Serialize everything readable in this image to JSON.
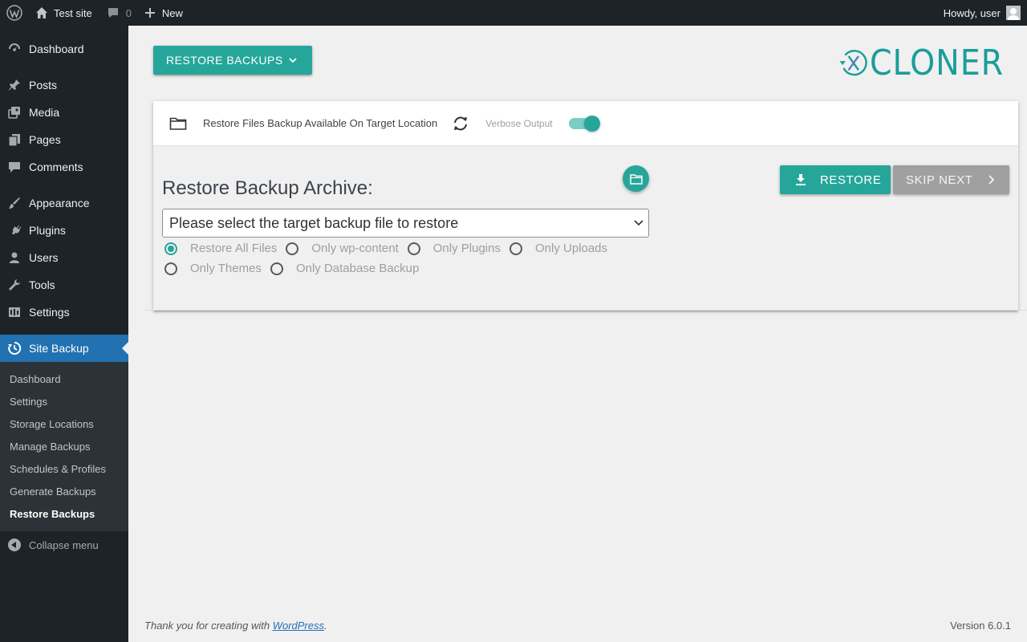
{
  "adminbar": {
    "site_name": "Test site",
    "comments_count": "0",
    "new_label": "New",
    "howdy": "Howdy, user"
  },
  "sidebar": {
    "items": [
      {
        "label": "Dashboard",
        "icon": "dashboard-icon"
      },
      {
        "label": "Posts",
        "icon": "pin-icon"
      },
      {
        "label": "Media",
        "icon": "media-icon"
      },
      {
        "label": "Pages",
        "icon": "pages-icon"
      },
      {
        "label": "Comments",
        "icon": "comments-icon"
      },
      {
        "label": "Appearance",
        "icon": "brush-icon"
      },
      {
        "label": "Plugins",
        "icon": "plugin-icon"
      },
      {
        "label": "Users",
        "icon": "users-icon"
      },
      {
        "label": "Tools",
        "icon": "wrench-icon"
      },
      {
        "label": "Settings",
        "icon": "settings-icon"
      },
      {
        "label": "Site Backup",
        "icon": "backup-icon",
        "current": true
      }
    ],
    "submenu": [
      "Dashboard",
      "Settings",
      "Storage Locations",
      "Manage Backups",
      "Schedules & Profiles",
      "Generate Backups",
      "Restore Backups"
    ],
    "current_submenu": "Restore Backups",
    "collapse_label": "Collapse menu"
  },
  "main": {
    "menu_button_label": "RESTORE BACKUPS",
    "logo_text": "CLONER",
    "card": {
      "head_title": "Restore Files Backup Available On Target Location",
      "verbose_label": "Verbose Output",
      "verbose_on": true,
      "archive_label": "Restore Backup Archive:",
      "select_value": "Please select the target backup file to restore",
      "radio_options": [
        {
          "label": "Restore All Files",
          "checked": true
        },
        {
          "label": "Only wp-content",
          "checked": false
        },
        {
          "label": "Only Plugins",
          "checked": false
        },
        {
          "label": "Only Uploads",
          "checked": false
        },
        {
          "label": "Only Themes",
          "checked": false
        },
        {
          "label": "Only Database Backup",
          "checked": false
        }
      ],
      "restore_label": "RESTORE",
      "skip_label": "SKIP NEXT"
    }
  },
  "footer": {
    "thanks_prefix": "Thank you for creating with ",
    "thanks_link": "WordPress",
    "thanks_suffix": ".",
    "version": "Version 6.0.1"
  },
  "colors": {
    "accent": "#26a69a",
    "admin_dark": "#1d2327",
    "wp_blue": "#2271b1"
  }
}
